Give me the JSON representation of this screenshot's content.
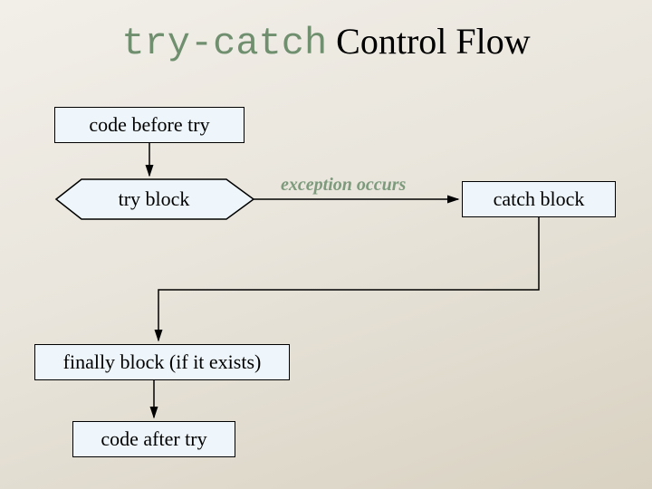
{
  "title": {
    "mono": "try-catch",
    "rest": " Control Flow"
  },
  "nodes": {
    "before": "code before try",
    "try": "try block",
    "catch": "catch block",
    "finally": "finally block (if it exists)",
    "after": "code after try"
  },
  "edges": {
    "exception": "exception occurs"
  },
  "chart_data": {
    "type": "flowchart",
    "title": "try-catch Control Flow",
    "nodes": [
      {
        "id": "before",
        "shape": "rect",
        "label": "code before try"
      },
      {
        "id": "try",
        "shape": "diamond",
        "label": "try block"
      },
      {
        "id": "catch",
        "shape": "rect",
        "label": "catch block"
      },
      {
        "id": "finally",
        "shape": "rect",
        "label": "finally block (if it exists)"
      },
      {
        "id": "after",
        "shape": "rect",
        "label": "code after try"
      }
    ],
    "edges": [
      {
        "from": "before",
        "to": "try",
        "label": ""
      },
      {
        "from": "try",
        "to": "catch",
        "label": "exception occurs"
      },
      {
        "from": "catch",
        "to": "finally",
        "label": ""
      },
      {
        "from": "finally",
        "to": "after",
        "label": ""
      }
    ]
  }
}
